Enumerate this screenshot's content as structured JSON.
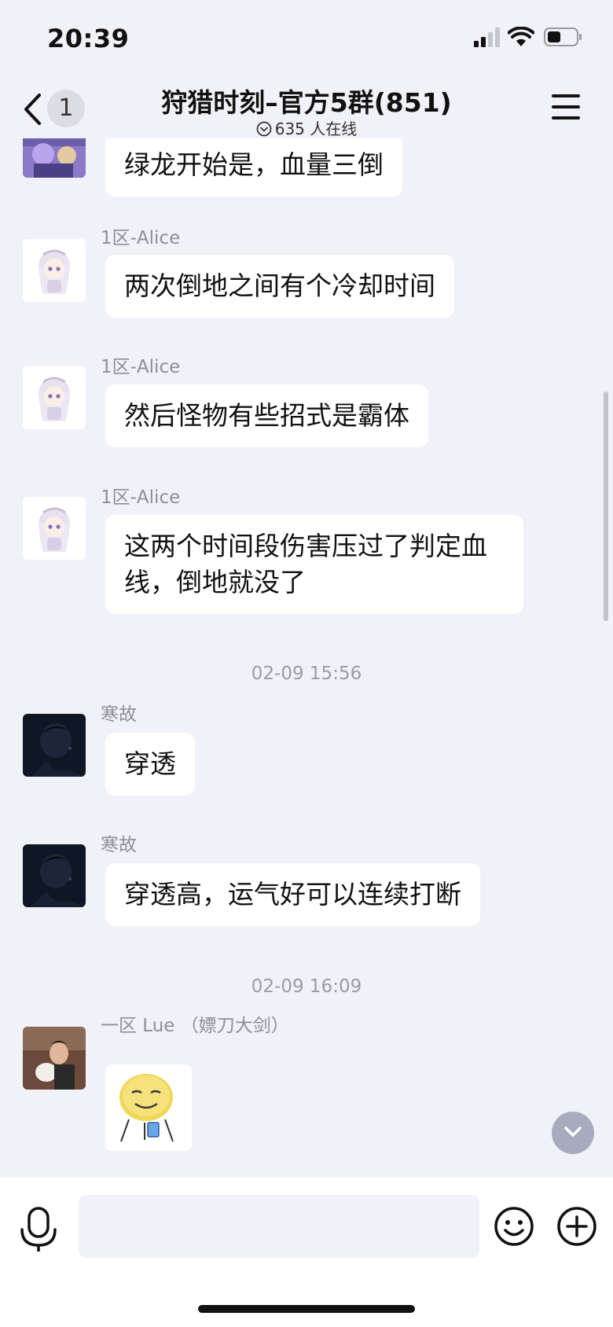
{
  "status_bar": {
    "time": "20:39",
    "icons": [
      "cellular-signal-icon",
      "wifi-icon",
      "battery-icon"
    ]
  },
  "header": {
    "back_icon": "chevron-left-icon",
    "unread_count": "1",
    "title": "狩猎时刻–官方5群(851)",
    "online_icon": "chevron-down-circle-icon",
    "online_text": "635 人在线",
    "menu_icon": "hamburger-menu-icon"
  },
  "messages": [
    {
      "sender": "",
      "text": "绿龙开始是，血量三倒"
    },
    {
      "sender": "1区-Alice",
      "text": "两次倒地之间有个冷却时间"
    },
    {
      "sender": "1区-Alice",
      "text": "然后怪物有些招式是霸体"
    },
    {
      "sender": "1区-Alice",
      "text": "这两个时间段伤害压过了判定血线，倒地就没了"
    },
    {
      "sender": "寒故",
      "text": "穿透"
    },
    {
      "sender": "寒故",
      "text": "穿透高，运气好可以连续打断"
    },
    {
      "sender": "一区 Lue （嫖刀大剑）",
      "text": ""
    }
  ],
  "timestamps": [
    "02-09 15:56",
    "02-09 16:09"
  ],
  "sticker": {
    "type": "smiley-sticker"
  },
  "scroll_down_icon": "chevron-down-icon",
  "input_bar": {
    "voice_icon": "microphone-icon",
    "placeholder": "",
    "emoji_icon": "smiley-face-icon",
    "plus_icon": "plus-circle-icon"
  },
  "colors": {
    "background": "#f1f2f7",
    "bubble": "#ffffff",
    "secondary_text": "#8c8f9a",
    "scroll_button": "#a7abbd"
  }
}
